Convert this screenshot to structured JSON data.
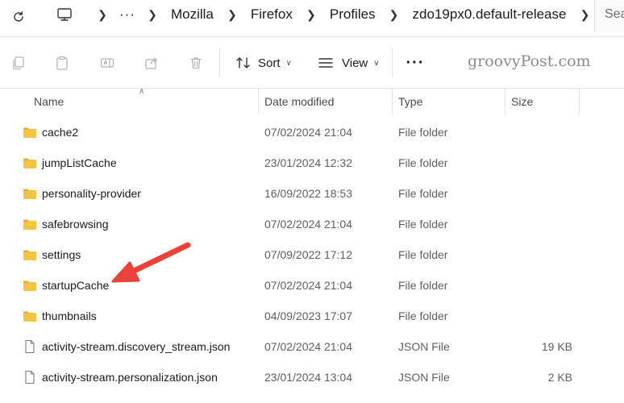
{
  "address_bar": {
    "refresh_icon": "refresh-icon",
    "crumbs": [
      "Mozilla",
      "Firefox",
      "Profiles",
      "zdo19px0.default-release"
    ],
    "overflow": "···",
    "search_placeholder": "Sea"
  },
  "toolbar": {
    "sort_label": "Sort",
    "view_label": "View",
    "more_label": "···"
  },
  "watermark": "groovyPost.com",
  "columns": {
    "name": "Name",
    "date_modified": "Date modified",
    "type": "Type",
    "size": "Size"
  },
  "files": [
    {
      "name": "cache2",
      "date": "07/02/2024 21:04",
      "type": "File folder",
      "size": "",
      "kind": "folder"
    },
    {
      "name": "jumpListCache",
      "date": "23/01/2024 12:32",
      "type": "File folder",
      "size": "",
      "kind": "folder"
    },
    {
      "name": "personality-provider",
      "date": "16/09/2022 18:53",
      "type": "File folder",
      "size": "",
      "kind": "folder"
    },
    {
      "name": "safebrowsing",
      "date": "07/02/2024 21:04",
      "type": "File folder",
      "size": "",
      "kind": "folder"
    },
    {
      "name": "settings",
      "date": "07/09/2022 17:12",
      "type": "File folder",
      "size": "",
      "kind": "folder"
    },
    {
      "name": "startupCache",
      "date": "07/02/2024 21:04",
      "type": "File folder",
      "size": "",
      "kind": "folder"
    },
    {
      "name": "thumbnails",
      "date": "04/09/2023 17:07",
      "type": "File folder",
      "size": "",
      "kind": "folder"
    },
    {
      "name": "activity-stream.discovery_stream.json",
      "date": "07/02/2024 21:04",
      "type": "JSON File",
      "size": "19 KB",
      "kind": "file"
    },
    {
      "name": "activity-stream.personalization.json",
      "date": "23/01/2024 13:04",
      "type": "JSON File",
      "size": "2 KB",
      "kind": "file"
    }
  ],
  "colors": {
    "folder": "#f4c542",
    "folder_dark": "#e6b022",
    "annotation_arrow": "#e8423a"
  }
}
